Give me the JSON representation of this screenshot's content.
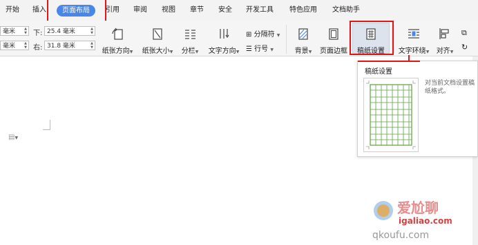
{
  "menubar": {
    "tabs": [
      {
        "label": "开始"
      },
      {
        "label": "插入"
      },
      {
        "label": "页面布局",
        "active": true
      },
      {
        "label": "引用"
      },
      {
        "label": "审阅"
      },
      {
        "label": "视图"
      },
      {
        "label": "章节"
      },
      {
        "label": "安全"
      },
      {
        "label": "开发工具"
      },
      {
        "label": "特色应用"
      },
      {
        "label": "文档助手"
      }
    ]
  },
  "ribbon": {
    "margins": {
      "left_top_value": "毫米",
      "left_bottom_value": "毫米",
      "bottom_label": "下:",
      "bottom_value": "25.4 毫米",
      "right_label": "右:",
      "right_value": "31.8 毫米"
    },
    "buttons": {
      "orientation": "纸张方向",
      "size": "纸张大小",
      "columns": "分栏",
      "text_direction": "文字方向",
      "separator": "分隔符",
      "line_number": "行号",
      "background": "背景",
      "page_border": "页面边框",
      "grid_settings": "稿纸设置",
      "text_wrap": "文字环绕",
      "align": "对齐"
    },
    "accent_color": "#4a86e8",
    "highlight_color": "#e01515"
  },
  "tooltip": {
    "title": "稿纸设置",
    "description": "对当前文档设置稿纸格式。",
    "grid_color": "#5aa03c"
  },
  "watermark": {
    "text_top": "爱尬聊",
    "text_url": "igaliao.com",
    "text_bottom": "qkoufu.com"
  }
}
